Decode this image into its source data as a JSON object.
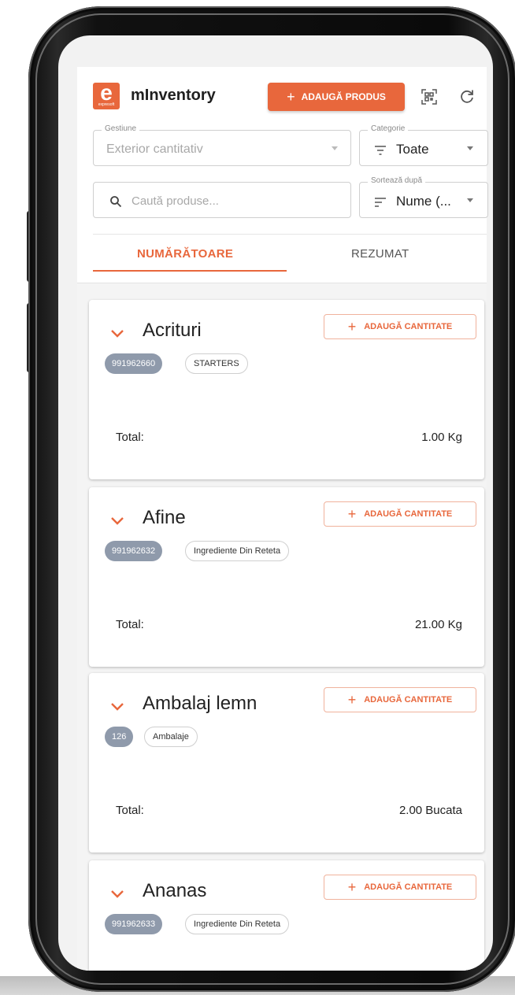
{
  "app": {
    "title": "mInventory",
    "logo_letter": "e",
    "logo_sub": "expresoft",
    "add_product_label": "ADAUGĂ PRODUS",
    "add_product_plus": "+"
  },
  "filters": {
    "gestiune": {
      "label": "Gestiune",
      "value": "Exterior cantitativ"
    },
    "categorie": {
      "label": "Categorie",
      "value": "Toate"
    },
    "search": {
      "placeholder": "Caută produse..."
    },
    "sort": {
      "label": "Sortează după",
      "value": "Nume (..."
    }
  },
  "tabs": [
    {
      "label": "NUMĂRĂTOARE",
      "active": true
    },
    {
      "label": "REZUMAT",
      "active": false
    }
  ],
  "add_quantity_label": "ADAUGĂ CANTITATE",
  "add_quantity_plus": "+",
  "total_label": "Total:",
  "products": [
    {
      "name": "Acrituri",
      "code": "991962660",
      "category": "STARTERS",
      "total": "1.00 Kg"
    },
    {
      "name": "Afine",
      "code": "991962632",
      "category": "Ingrediente Din Reteta",
      "total": "21.00 Kg"
    },
    {
      "name": "Ambalaj lemn",
      "code": "126",
      "category": "Ambalaje",
      "total": "2.00 Bucata"
    },
    {
      "name": "Ananas",
      "code": "991962633",
      "category": "Ingrediente Din Reteta",
      "total": ""
    }
  ],
  "colors": {
    "accent": "#e8673c",
    "chip": "#8f9aab"
  }
}
